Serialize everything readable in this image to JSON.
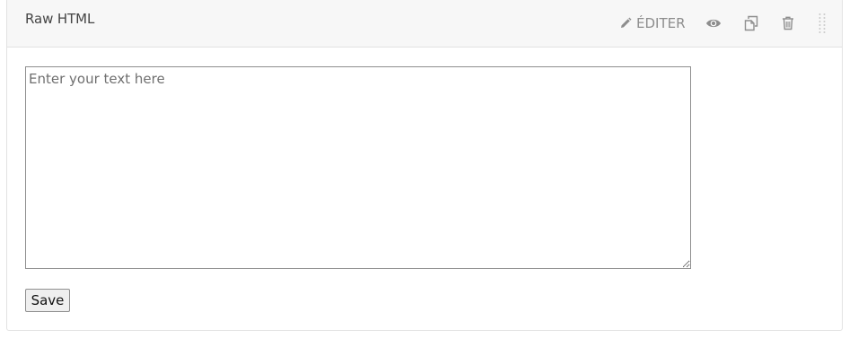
{
  "block": {
    "title": "Raw HTML",
    "edit_label": "ÉDITER",
    "icons": {
      "edit": "pencil-icon",
      "preview": "eye-icon",
      "duplicate": "copy-icon",
      "delete": "trash-icon",
      "drag": "drag-handle-icon"
    }
  },
  "editor": {
    "value": "",
    "placeholder": "Enter your text here"
  },
  "form": {
    "save_label": "Save"
  }
}
